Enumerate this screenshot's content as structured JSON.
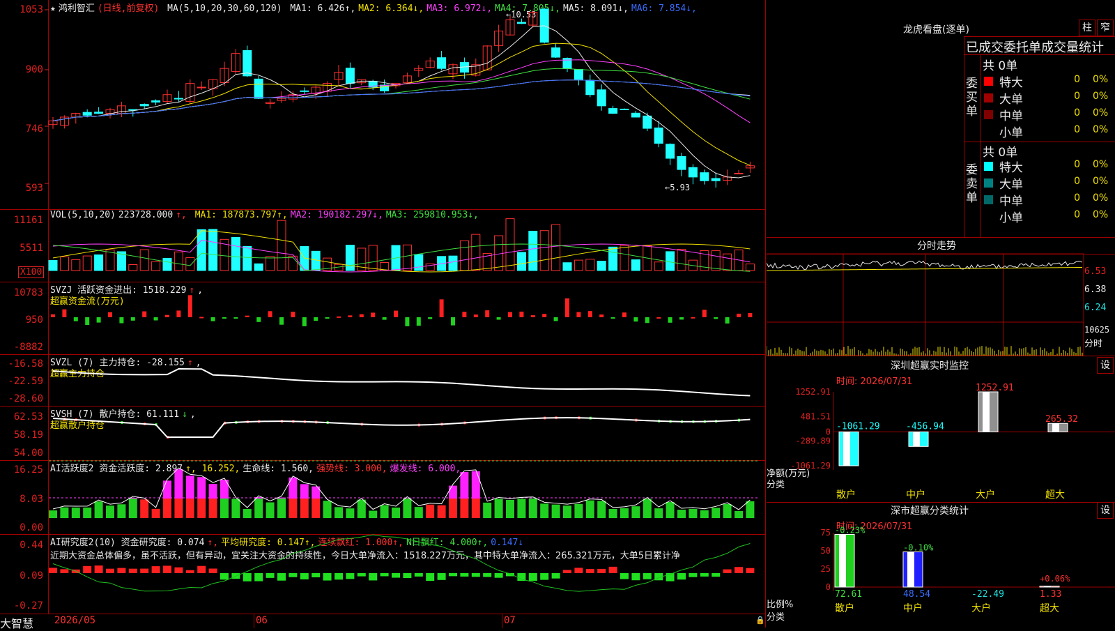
{
  "title": {
    "star": "★",
    "name": "鸿利智汇",
    "mode": "(日线,前复权)"
  },
  "kline": {
    "ma_header": "MA(5,10,20,30,60,120)",
    "ma": [
      {
        "label": "MA1: 6.426",
        "arrow": "↑",
        "color": "#e8e8e8"
      },
      {
        "label": "MA2: 6.364",
        "arrow": "↓",
        "color": "#f0e000"
      },
      {
        "label": "MA3: 6.972",
        "arrow": "↓",
        "color": "#ff40ff"
      },
      {
        "label": "MA4: 7.805",
        "arrow": "↓",
        "color": "#40e040"
      },
      {
        "label": "MA5: 8.091",
        "arrow": "↓",
        "color": "#e8e8e8"
      },
      {
        "label": "MA6: 7.854",
        "arrow": "↓",
        "color": "#3a6cff"
      }
    ],
    "y_ticks": [
      "1053",
      "900",
      "746",
      "593"
    ],
    "high_label": "10.53",
    "low_label": "5.93"
  },
  "vol": {
    "header": "VOL(5,10,20)",
    "value": "223728.000",
    "ma": [
      {
        "label": "MA1: 187873.797",
        "arrow": "↑",
        "color": "#f0e000"
      },
      {
        "label": "MA2: 190182.297",
        "arrow": "↓",
        "color": "#ff40ff"
      },
      {
        "label": "MA3: 259810.953",
        "arrow": "↓",
        "color": "#40e040"
      }
    ],
    "y_ticks": [
      "11161",
      "5511"
    ],
    "unit": "X100"
  },
  "svzj": {
    "header": "SVZJ  活跃资金进出: 1518.229",
    "arrow": "↑",
    "sub": "超赢资金流(万元)",
    "y_ticks": [
      "10783",
      "950",
      "-8882"
    ]
  },
  "svzl": {
    "header": "SVZL (7) 主力持仓: -28.155",
    "arrow": "↑",
    "sub": "超赢主力持仓",
    "y_ticks": [
      "-16.58",
      "-22.59",
      "-28.60"
    ]
  },
  "svsh": {
    "header": "SVSH (7) 散户持仓: 61.111",
    "arrow": "↓",
    "sub": "超赢散户持仓",
    "y_ticks": [
      "62.53",
      "58.19",
      "54.00"
    ]
  },
  "ai_active": {
    "header": "AI活跃度2 资金活跃度: 2.897",
    "parts": [
      {
        "t": "↑, 16.252,",
        "c": "#f0e000"
      },
      {
        "t": "生命线: 1.560,",
        "c": "#e8e8e8"
      },
      {
        "t": "强势线: 3.000,",
        "c": "#ff3030"
      },
      {
        "t": "爆发线: 6.000,",
        "c": "#ff40ff"
      }
    ],
    "y_ticks": [
      "16.25",
      "8.03",
      "0.00"
    ]
  },
  "ai_research": {
    "header": "AI研究度2(10) 资金研究度: 0.074",
    "parts": [
      {
        "t": "↑,",
        "c": "#ff3030"
      },
      {
        "t": "平均研究度: 0.147↑,",
        "c": "#f0e000"
      },
      {
        "t": "连续飘红: 1.000↑,",
        "c": "#ff3030"
      },
      {
        "t": "N日飘红: 4.000↑,",
        "c": "#40e040"
      },
      {
        "t": "0.147↓",
        "c": "#3a6cff"
      }
    ],
    "comment": "近期大资金总体偏多，虽不活跃，但有异动，宜关注大资金的持续性，今日大单净流入：1518.227万元，其中特大单净流入：265.321万元，大单5日累计净",
    "y_ticks": [
      "0.44",
      "0.09",
      "-0.27"
    ]
  },
  "xaxis": {
    "brand": "大智慧",
    "labels": [
      "2026/05",
      "06",
      "07"
    ]
  },
  "dragon": {
    "title": "龙虎看盘(逐单)",
    "btn_zhu": "柱",
    "btn_wu": "窄",
    "tabs": "已成交委托单成交量统计",
    "buy_label": "委买单",
    "sell_label": "委卖单",
    "buy_total": "共 0单",
    "sell_total": "共 0单",
    "buy_rows": [
      {
        "name": "特大",
        "v": "0",
        "p": "0%",
        "color": "#ff0000"
      },
      {
        "name": "大单",
        "v": "0",
        "p": "0%",
        "color": "#a00000"
      },
      {
        "name": "中单",
        "v": "0",
        "p": "0%",
        "color": "#800000"
      },
      {
        "name": "小单",
        "v": "0",
        "p": "0%",
        "color": ""
      }
    ],
    "sell_rows": [
      {
        "name": "特大",
        "v": "0",
        "p": "0%",
        "color": "#00ffff"
      },
      {
        "name": "大单",
        "v": "0",
        "p": "0%",
        "color": "#008080"
      },
      {
        "name": "中单",
        "v": "0",
        "p": "0%",
        "color": "#006868"
      },
      {
        "name": "小单",
        "v": "0",
        "p": "0%",
        "color": ""
      }
    ]
  },
  "intraday": {
    "title": "分时走势",
    "y_ticks": [
      "6.53",
      "6.38",
      "6.24"
    ],
    "vol_label": "10625",
    "fen": "分时"
  },
  "sz_monitor": {
    "title": "深圳超赢实时监控",
    "set": "设",
    "time": "时间: 2026/07/31",
    "y_ticks": [
      "1252.91",
      "481.51",
      "0",
      "-289.89",
      "-1061.29"
    ],
    "ylabel": "净额(万元)",
    "xlabel": "分类",
    "cats": [
      "散户",
      "中户",
      "大户",
      "超大"
    ],
    "values": [
      -1061.29,
      -456.94,
      1252.91,
      265.32
    ],
    "value_labels": [
      "-1061.29",
      "-456.94",
      "1252.91",
      "265.32"
    ]
  },
  "sz_class": {
    "title": "深市超赢分类统计",
    "set": "设",
    "time": "时间: 2026/07/31",
    "y_ticks": [
      "75",
      "50",
      "25",
      "0"
    ],
    "ylabel": "比例%",
    "xlabel": "分类",
    "cats": [
      "散户",
      "中户",
      "大户",
      "超大"
    ],
    "values": [
      72.61,
      48.54,
      -22.49,
      1.33
    ],
    "value_labels": [
      "72.61",
      "48.54",
      "-22.49",
      "1.33"
    ],
    "change_labels": [
      "-0.23%",
      "-0.10%",
      "",
      "+0.06%"
    ]
  }
}
